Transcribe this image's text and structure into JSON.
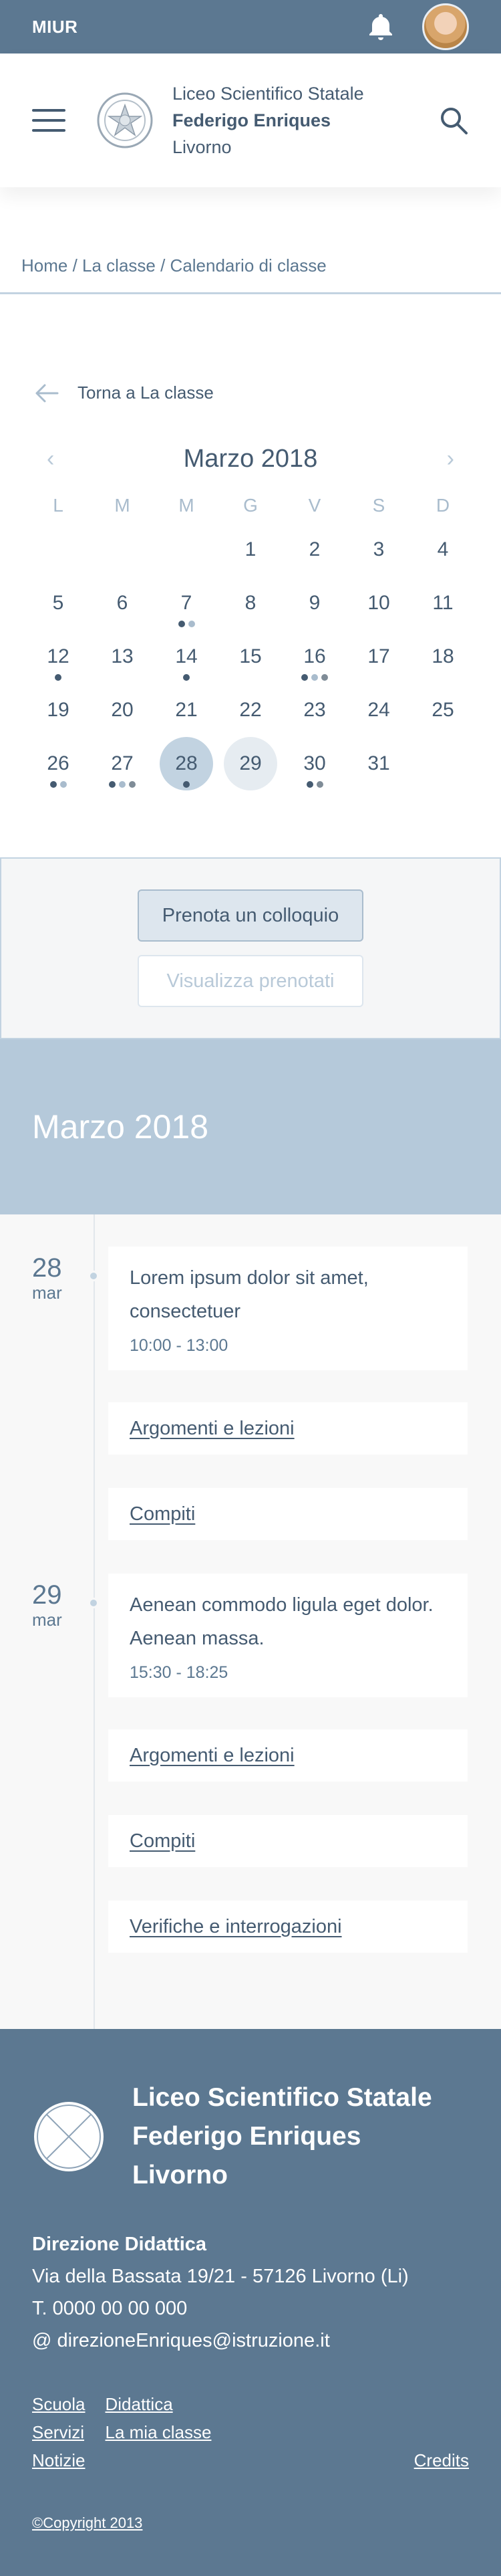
{
  "topbar": {
    "brand": "MIUR"
  },
  "header": {
    "school_line1": "Liceo Scientifico Statale",
    "school_line2": "Federigo Enriques",
    "school_line3": "Livorno"
  },
  "breadcrumb": "Home / La classe / Calendario di classe",
  "back_label": "Torna a La classe",
  "calendar": {
    "month_title": "Marzo 2018",
    "prev": "‹",
    "next": "›",
    "weekdays": [
      "L",
      "M",
      "M",
      "G",
      "V",
      "S",
      "D"
    ],
    "weeks": [
      [
        null,
        null,
        null,
        {
          "d": "1"
        },
        {
          "d": "2"
        },
        {
          "d": "3"
        },
        {
          "d": "4"
        }
      ],
      [
        {
          "d": "5"
        },
        {
          "d": "6"
        },
        {
          "d": "7",
          "dots": [
            "#455b71",
            "#a9bccd"
          ]
        },
        {
          "d": "8"
        },
        {
          "d": "9"
        },
        {
          "d": "10"
        },
        {
          "d": "11"
        }
      ],
      [
        {
          "d": "12",
          "dots": [
            "#455b71"
          ]
        },
        {
          "d": "13"
        },
        {
          "d": "14",
          "dots": [
            "#455b71"
          ]
        },
        {
          "d": "15"
        },
        {
          "d": "16",
          "dots": [
            "#455b71",
            "#a9bccd",
            "#7f8c97"
          ]
        },
        {
          "d": "17"
        },
        {
          "d": "18"
        }
      ],
      [
        {
          "d": "19"
        },
        {
          "d": "20"
        },
        {
          "d": "21"
        },
        {
          "d": "22"
        },
        {
          "d": "23"
        },
        {
          "d": "24"
        },
        {
          "d": "25"
        }
      ],
      [
        {
          "d": "26",
          "dots": [
            "#455b71",
            "#a9bccd"
          ]
        },
        {
          "d": "27",
          "dots": [
            "#455b71",
            "#a9bccd",
            "#7f8c97"
          ]
        },
        {
          "d": "28",
          "dots": [
            "#455b71"
          ],
          "state": "sel"
        },
        {
          "d": "29",
          "state": "today"
        },
        {
          "d": "30",
          "dots": [
            "#455b71",
            "#7f8c97"
          ]
        },
        {
          "d": "31"
        },
        null
      ]
    ]
  },
  "actions": {
    "book": "Prenota un colloquio",
    "view_booked": "Visualizza prenotati"
  },
  "month_band": "Marzo 2018",
  "timeline": [
    {
      "day": "28",
      "month": "mar",
      "event_title": "Lorem ipsum dolor sit amet, consectetuer",
      "event_time": "10:00 - 13:00",
      "links": [
        "Argomenti e lezioni",
        "Compiti"
      ]
    },
    {
      "day": "29",
      "month": "mar",
      "event_title": "Aenean commodo ligula eget dolor. Aenean massa.",
      "event_time": "15:30 - 18:25",
      "links": [
        "Argomenti e lezioni",
        "Compiti",
        "Verifiche e interrogazioni"
      ]
    }
  ],
  "footer": {
    "name_line1": "Liceo Scientifico Statale",
    "name_line2": "Federigo Enriques",
    "name_line3": "Livorno",
    "contacts_title": "Direzione Didattica",
    "address": "Via della Bassata 19/21 - 57126 Livorno (Li)",
    "phone": "T. 0000 00 00 000",
    "email": "@ direzioneEnriques@istruzione.it",
    "col1": [
      "Scuola",
      "Servizi",
      "Notizie"
    ],
    "col2": [
      "Didattica",
      "La mia classe"
    ],
    "credits": "Credits",
    "copyright": "©Copyright 2013"
  },
  "colors": {
    "topbar": "#5c7891",
    "primary_text": "#455b71",
    "month_band": "#b5c9da",
    "selected_day": "#c2d3e1",
    "today_day": "#e6ecf1"
  },
  "icons": [
    "bell-icon",
    "avatar",
    "hamburger-icon",
    "emblem-icon",
    "search-icon",
    "arrow-left-icon",
    "chevron-left-icon",
    "chevron-right-icon",
    "footer-logo"
  ]
}
